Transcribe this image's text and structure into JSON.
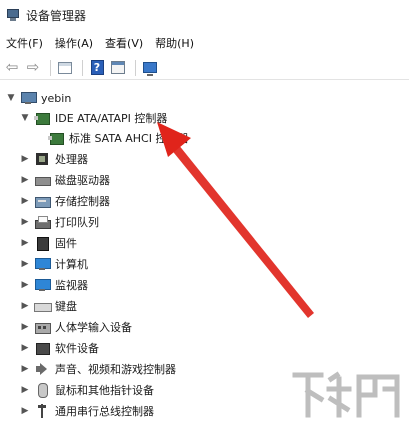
{
  "window": {
    "title": "设备管理器",
    "icon": "device-manager-icon"
  },
  "menu": [
    "文件(F)",
    "操作(A)",
    "查看(V)",
    "帮助(H)"
  ],
  "toolbar": {
    "buttons": [
      "back-arrow-icon",
      "forward-arrow-icon",
      "view-grid-icon",
      "help-icon",
      "properties-icon",
      "monitor-scan-icon"
    ]
  },
  "tree": {
    "root": "yebin",
    "ide_group": "IDE ATA/ATAPI 控制器",
    "ide_child": "标准 SATA AHCI 控制器",
    "items": [
      "处理器",
      "磁盘驱动器",
      "存储控制器",
      "打印队列",
      "固件",
      "计算机",
      "监视器",
      "键盘",
      "人体学输入设备",
      "软件设备",
      "声音、视频和游戏控制器",
      "鼠标和其他指针设备",
      "通用串行总线控制器"
    ]
  },
  "annotation": {
    "type": "red-arrow",
    "color": "#e0241b"
  },
  "watermark": {
    "brand": "下载吧"
  }
}
